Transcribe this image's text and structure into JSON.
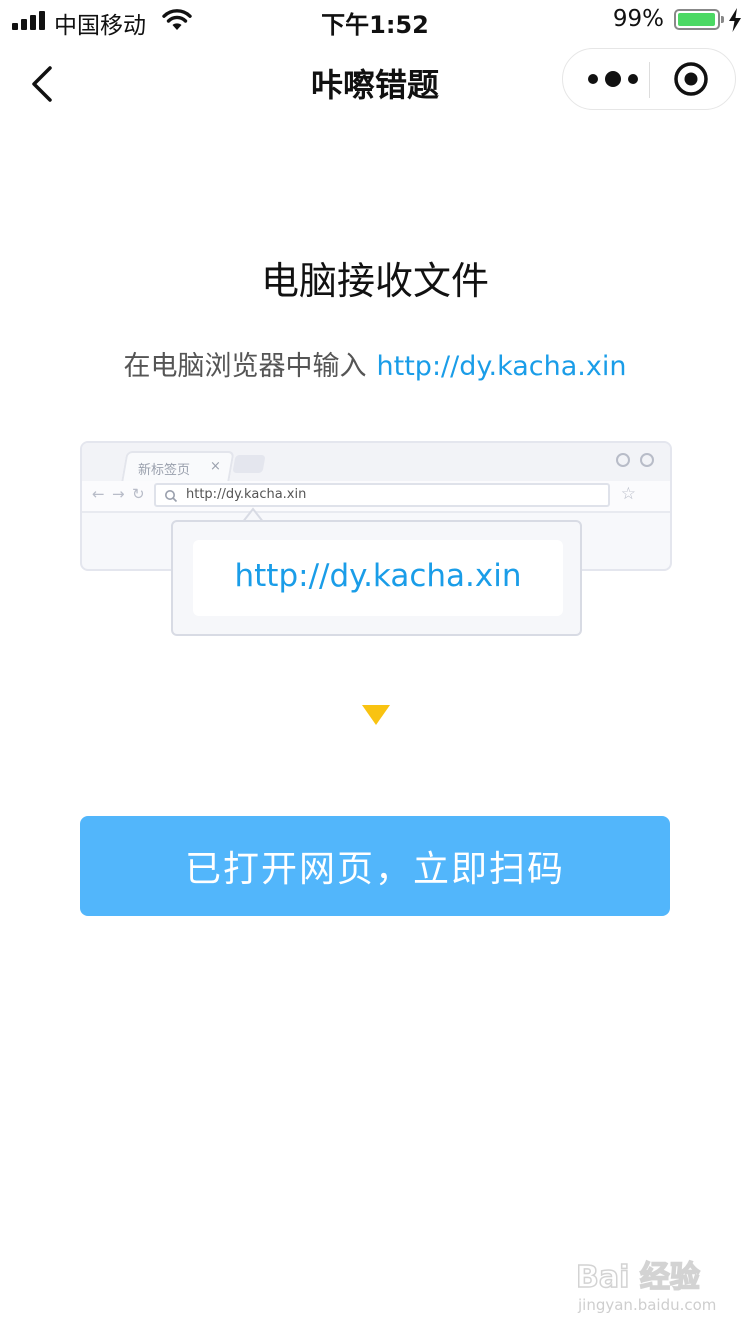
{
  "status_bar": {
    "carrier": "中国移动",
    "time": "下午1:52",
    "battery_percent": "99%",
    "battery_level": 0.99,
    "battery_color": "#4cd964"
  },
  "nav": {
    "back_icon": "chevron-left-icon",
    "title": "咔嚓错题",
    "more_icon": "more-dots-icon",
    "close_icon": "target-close-icon"
  },
  "main": {
    "headline": "电脑接收文件",
    "instruction_prefix": "在电脑浏览器中输入",
    "instruction_url": "http://dy.kacha.xin",
    "illustration": {
      "tab_label": "新标签页",
      "tab_close": "×",
      "address_url": "http://dy.kacha.xin",
      "callout_url": "http://dy.kacha.xin"
    },
    "arrow_icon": "triangle-down-icon",
    "arrow_color": "#f9c311",
    "button_label": "已打开网页，立即扫码",
    "button_color": "#52b6fb",
    "link_color": "#1a9de8"
  },
  "watermark": {
    "main": "Bai 经验",
    "sub": "jingyan.baidu.com"
  }
}
